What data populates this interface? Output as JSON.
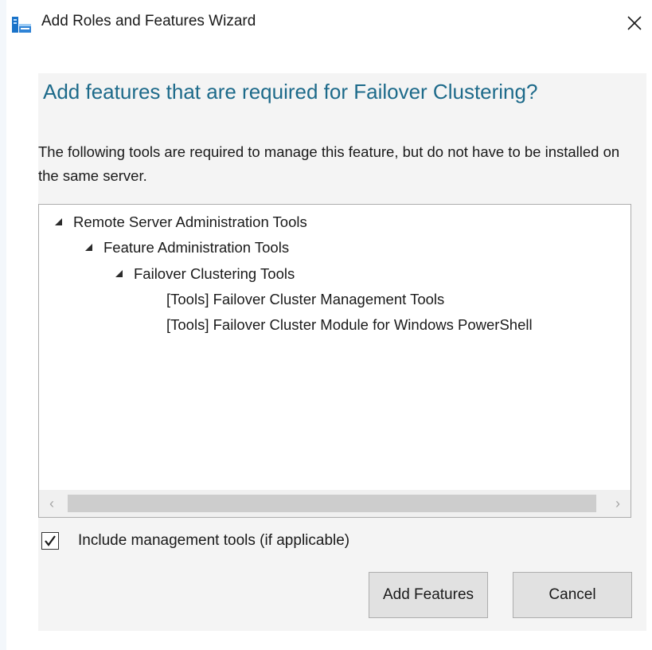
{
  "window": {
    "title": "Add Roles and Features Wizard",
    "icons": {
      "app": "server-manager-icon",
      "close": "close-icon"
    }
  },
  "dialog": {
    "heading": "Add features that are required for Failover Clustering?",
    "description": "The following tools are required to manage this feature, but do not have to be installed on the same server.",
    "tree": [
      {
        "label": "Remote Server Administration Tools",
        "level": 0,
        "expanded": true
      },
      {
        "label": "Feature Administration Tools",
        "level": 1,
        "expanded": true
      },
      {
        "label": "Failover Clustering Tools",
        "level": 2,
        "expanded": true
      },
      {
        "label": "[Tools] Failover Cluster Management Tools",
        "level": 3,
        "expanded": null
      },
      {
        "label": "[Tools] Failover Cluster Module for Windows PowerShell",
        "level": 3,
        "expanded": null
      }
    ],
    "scrollbar": {
      "left_glyph": "‹",
      "right_glyph": "›"
    },
    "include_tools": {
      "label": "Include management tools (if applicable)",
      "checked": true
    },
    "buttons": {
      "add": "Add Features",
      "cancel": "Cancel"
    }
  },
  "colors": {
    "heading": "#1d6a8a",
    "panel": "#f4f4f4",
    "button": "#e1e1e1"
  }
}
